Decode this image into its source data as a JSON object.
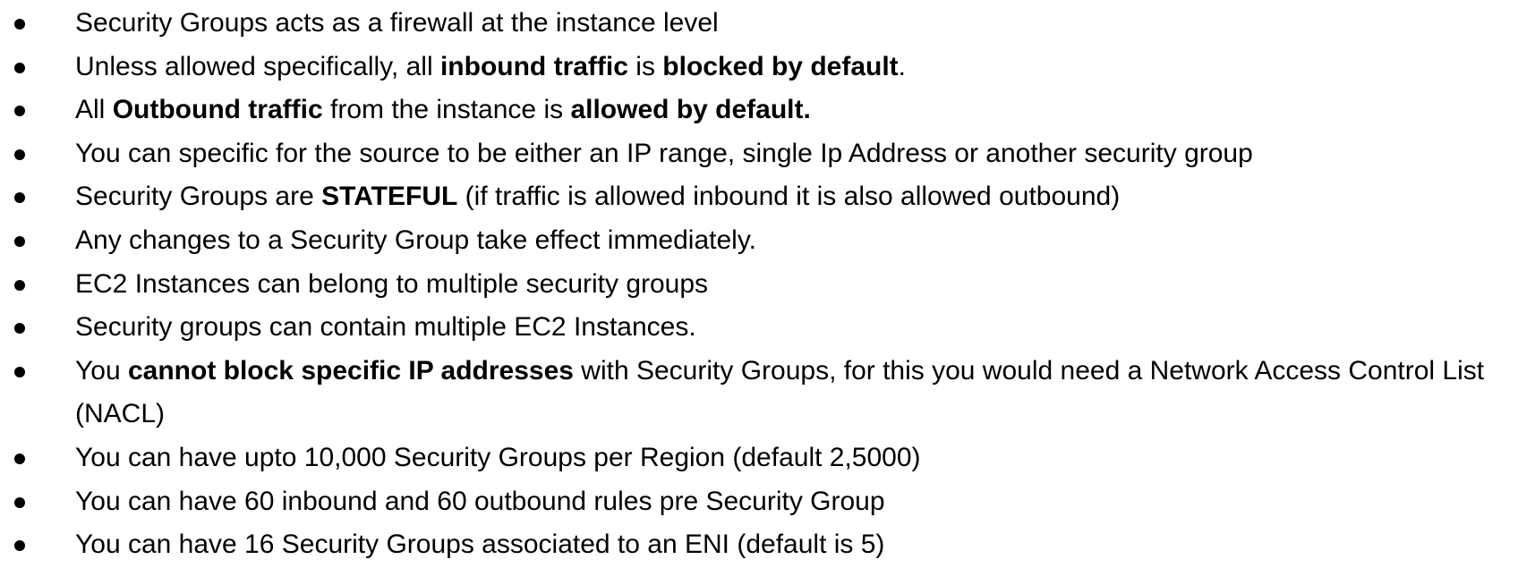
{
  "bullets": [
    {
      "segments": [
        {
          "text": "Security Groups acts as a firewall at the instance level",
          "bold": false
        }
      ]
    },
    {
      "segments": [
        {
          "text": "Unless allowed specifically, all ",
          "bold": false
        },
        {
          "text": "inbound traffic",
          "bold": true
        },
        {
          "text": " is ",
          "bold": false
        },
        {
          "text": "blocked by default",
          "bold": true
        },
        {
          "text": ".",
          "bold": false
        }
      ]
    },
    {
      "segments": [
        {
          "text": "All ",
          "bold": false
        },
        {
          "text": "Outbound traffic",
          "bold": true
        },
        {
          "text": " from the instance is ",
          "bold": false
        },
        {
          "text": "allowed by default.",
          "bold": true
        }
      ]
    },
    {
      "segments": [
        {
          "text": "You can specific for the source to be either an IP range, single Ip Address or another security group",
          "bold": false
        }
      ]
    },
    {
      "segments": [
        {
          "text": "Security Groups are ",
          "bold": false
        },
        {
          "text": "STATEFUL",
          "bold": true
        },
        {
          "text": "  (if traffic is allowed inbound it is also allowed outbound)",
          "bold": false
        }
      ]
    },
    {
      "segments": [
        {
          "text": "Any changes to a Security Group take effect immediately.",
          "bold": false
        }
      ]
    },
    {
      "segments": [
        {
          "text": "EC2 Instances can belong to multiple security groups",
          "bold": false
        }
      ]
    },
    {
      "segments": [
        {
          "text": "Security groups can contain multiple EC2 Instances.",
          "bold": false
        }
      ]
    },
    {
      "segments": [
        {
          "text": "You ",
          "bold": false
        },
        {
          "text": "cannot block specific IP addresses",
          "bold": true
        },
        {
          "text": " with Security Groups, for this you would need a Network Access Control List (NACL)",
          "bold": false
        }
      ]
    },
    {
      "segments": [
        {
          "text": "You can have upto 10,000 Security Groups per Region (default 2,5000)",
          "bold": false
        }
      ]
    },
    {
      "segments": [
        {
          "text": "You can have 60 inbound and 60 outbound rules pre Security Group",
          "bold": false
        }
      ]
    },
    {
      "segments": [
        {
          "text": "You can have 16 Security Groups associated to an ENI (default is 5)",
          "bold": false
        }
      ]
    }
  ]
}
